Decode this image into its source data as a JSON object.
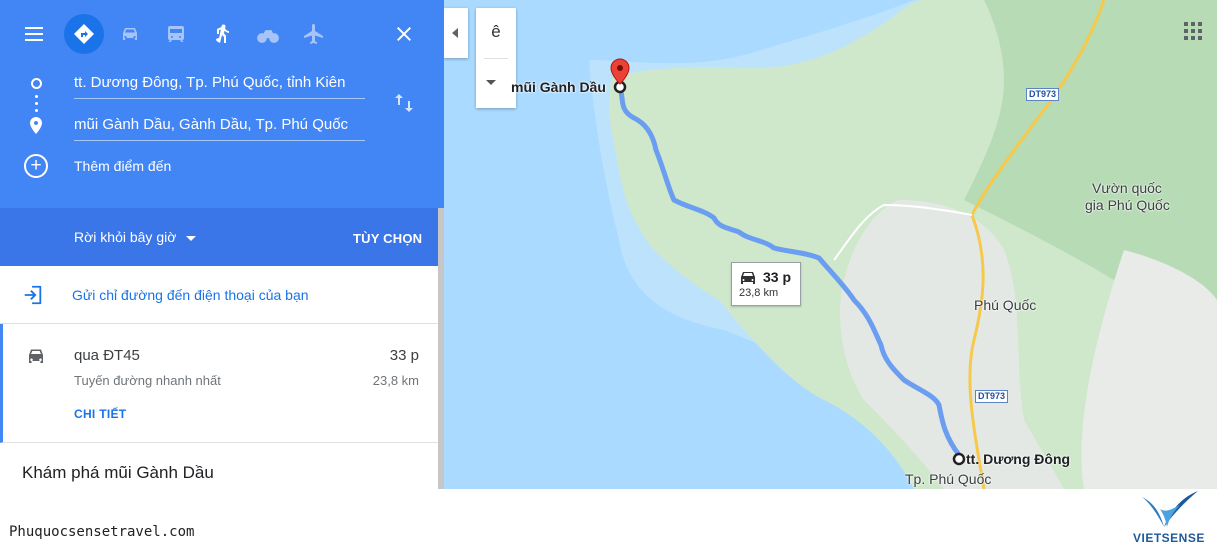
{
  "panel": {
    "modes": [
      {
        "name": "menu"
      },
      {
        "name": "best-route"
      },
      {
        "name": "driving"
      },
      {
        "name": "transit"
      },
      {
        "name": "walking"
      },
      {
        "name": "cycling"
      },
      {
        "name": "flights"
      }
    ],
    "origin": "tt. Dương Đông, Tp. Phú Quốc, tỉnh Kiên",
    "destination": "mũi Gành Dầu, Gành Dầu, Tp. Phú Quốc",
    "add_destination": "Thêm điểm đến",
    "depart_label": "Rời khỏi bây giờ",
    "options_label": "TÙY CHỌN",
    "send_label": "Gửi chỉ đường đến điện thoại của bạn",
    "route": {
      "via": "qua ĐT45",
      "time": "33 p",
      "description": "Tuyến đường nhanh nhất",
      "distance": "23,8 km",
      "details": "CHI TIẾT"
    },
    "explore_title": "Khám phá mũi Gành Dầu",
    "accent": "#4285f4"
  },
  "map": {
    "language_glyph": "ê",
    "destination_label": "mũi Gành Dầu",
    "origin_label": "tt. Dương Đông",
    "city_label": "Tp. Phú Quốc",
    "town_label": "Phú Quốc",
    "park_label_1": "Vườn quốc",
    "park_label_2": "gia Phú Quốc",
    "road_shield_1": "DT973",
    "road_shield_2": "DT973",
    "info_time": "33 p",
    "info_distance": "23,8 km",
    "route_color": "#6b9ef0"
  },
  "footer": {
    "site_url": "Phuquocsensetravel.com",
    "brand": "VIETSENSE"
  }
}
